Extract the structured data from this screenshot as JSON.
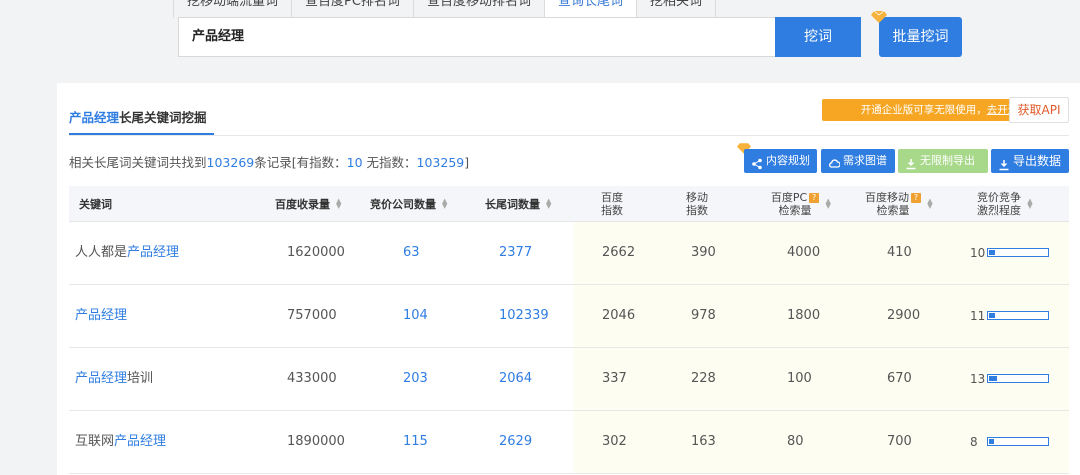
{
  "tabs": [
    {
      "label": "挖移动端流量词",
      "active": false
    },
    {
      "label": "查百度PC排名词",
      "active": false
    },
    {
      "label": "查百度移动排名词",
      "active": false
    },
    {
      "label": "查询长尾词",
      "active": true
    },
    {
      "label": "挖相关词",
      "active": false
    }
  ],
  "search": {
    "value": "产品经理",
    "button": "挖词",
    "batch_button": "批量挖词"
  },
  "panel": {
    "title_keyword": "产品经理",
    "title_rest": "长尾关键词挖掘",
    "enterprise_text": "开通企业版可享无限使用，",
    "enterprise_link": "去开通",
    "api_button": "获取API"
  },
  "summary": {
    "prefix": "相关长尾词关键词共找到",
    "total": "103269",
    "mid": "条记录[有指数：",
    "with_index": "10",
    "mid2": " 无指数：",
    "without_index": "103259",
    "suffix": "]"
  },
  "actions": {
    "content_plan": "内容规划",
    "demand_map": "需求图谱",
    "unlimited_export": "无限制导出",
    "export_data": "导出数据"
  },
  "table": {
    "headers": {
      "keyword": "关键词",
      "baidu_included": "百度收录量",
      "bid_companies": "竞价公司数量",
      "longtail_count": "长尾词数量",
      "baidu_index_1": "百度",
      "baidu_index_2": "指数",
      "mobile_index_1": "移动",
      "mobile_index_2": "指数",
      "pc_search_1": "百度PC",
      "pc_search_2": "检索量",
      "mobile_search_1": "百度移动",
      "mobile_search_2": "检索量",
      "competition_1": "竞价竞争",
      "competition_2": "激烈程度",
      "help_mark": "?"
    },
    "rows": [
      {
        "kw_pre": "人人都是",
        "kw_hl": "产品经理",
        "kw_post": "",
        "included": "1620000",
        "companies": "63",
        "longtail": "2377",
        "baidu_index": "2662",
        "mobile_index": "390",
        "pc_search": "4000",
        "mobile_search": "410",
        "competition": "10"
      },
      {
        "kw_pre": "",
        "kw_hl": "产品经理",
        "kw_post": "",
        "included": "757000",
        "companies": "104",
        "longtail": "102339",
        "baidu_index": "2046",
        "mobile_index": "978",
        "pc_search": "1800",
        "mobile_search": "2900",
        "competition": "11"
      },
      {
        "kw_pre": "",
        "kw_hl": "产品经理",
        "kw_post": "培训",
        "included": "433000",
        "companies": "203",
        "longtail": "2064",
        "baidu_index": "337",
        "mobile_index": "228",
        "pc_search": "100",
        "mobile_search": "670",
        "competition": "13"
      },
      {
        "kw_pre": "互联网",
        "kw_hl": "产品经理",
        "kw_post": "",
        "included": "1890000",
        "companies": "115",
        "longtail": "2629",
        "baidu_index": "302",
        "mobile_index": "163",
        "pc_search": "80",
        "mobile_search": "700",
        "competition": "8"
      }
    ]
  },
  "colors": {
    "accent": "#2f7de1",
    "orange": "#f6a623",
    "api_text": "#e05a2a",
    "disabled_green": "#a8d98a"
  }
}
